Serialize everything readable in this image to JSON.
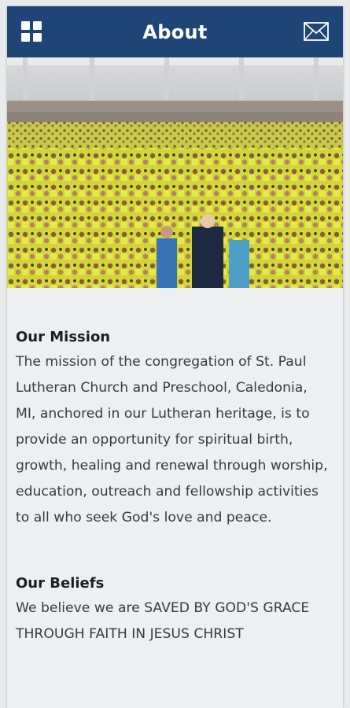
{
  "header": {
    "title": "About",
    "background": "#1f4577",
    "menu_icon": "grid-menu-icon",
    "mail_icon": "mail-icon"
  },
  "hero": {
    "image": "group-photo"
  },
  "sections": [
    {
      "heading": "Our Mission",
      "body": "The mission of the congregation of St. Paul Lutheran Church and Preschool, Caledonia, MI, anchored in our Lutheran heritage, is to provide an opportunity for spiritual birth, growth, healing and renewal through worship, education, outreach and fellowship activities to all who seek God's love and peace."
    },
    {
      "heading": "Our Beliefs",
      "body": "We believe we are SAVED BY GOD'S GRACE THROUGH FAITH IN JESUS CHRIST"
    }
  ]
}
